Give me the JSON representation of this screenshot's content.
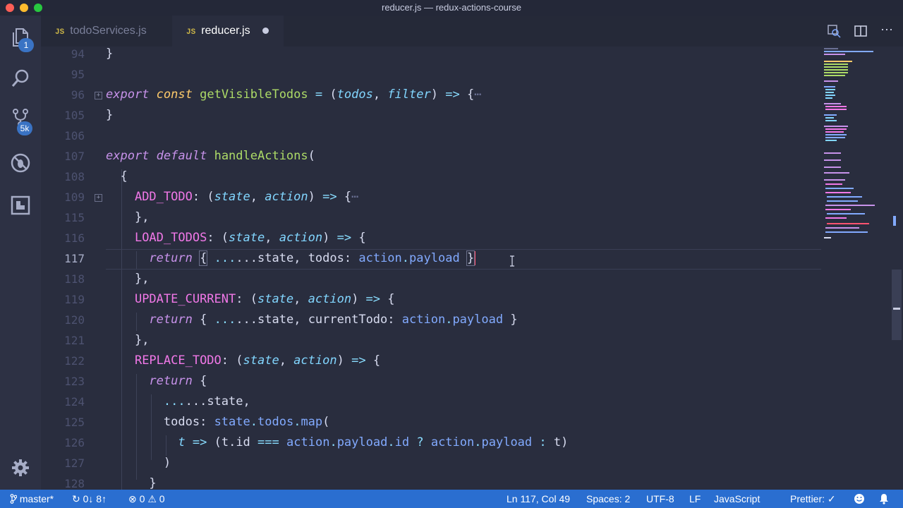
{
  "window": {
    "title": "reducer.js — redux-actions-course"
  },
  "activity_bar": {
    "explorer_badge": "1",
    "scm_badge": "5k"
  },
  "tabs": [
    {
      "icon": "JS",
      "label": "todoServices.js"
    },
    {
      "icon": "JS",
      "label": "reducer.js"
    }
  ],
  "editor": {
    "line_numbers": [
      "94",
      "95",
      "96",
      "105",
      "106",
      "107",
      "108",
      "109",
      "115",
      "116",
      "117",
      "118",
      "119",
      "120",
      "121",
      "122",
      "123",
      "124",
      "125",
      "126",
      "127",
      "128"
    ],
    "code": {
      "l94": "}",
      "l96_export": "export",
      "l96_const": "const",
      "l96_fn": "getVisibleTodos",
      "l96_eq": "=",
      "l96_p1": "todos",
      "l96_p2": "filter",
      "l96_fold": "⋯",
      "l105": "}",
      "l107_export": "export",
      "l107_default": "default",
      "l107_fn": "handleActions",
      "l108": "{",
      "l109_key": "ADD_TODO",
      "l109_p1": "state",
      "l109_p2": "action",
      "l109_fold": "⋯",
      "l115": "},",
      "l116_key": "LOAD_TODOS",
      "l116_p1": "state",
      "l116_p2": "action",
      "l117_return": "return",
      "l117_spread": "...state,",
      "l117_todos": "todos:",
      "l117_action": "action",
      "l117_payload": "payload",
      "l118": "},",
      "l119_key": "UPDATE_CURRENT",
      "l119_p1": "state",
      "l119_p2": "action",
      "l120_return": "return",
      "l120_spread": "...state,",
      "l120_cur": "currentTodo:",
      "l120_action": "action",
      "l120_payload": "payload",
      "l121": "},",
      "l122_key": "REPLACE_TODO",
      "l122_p1": "state",
      "l122_p2": "action",
      "l123_return": "return",
      "l124_spread": "...state,",
      "l125_todos": "todos:",
      "l125_state": "state",
      "l125_todos2": "todos",
      "l125_map": "map",
      "l126_t": "t",
      "l126_tid": "t.id",
      "l126_action": "action",
      "l126_payload": "payload",
      "l126_id": "id",
      "l126_action2": "action",
      "l126_payload2": "payload",
      "l126_t2": "t",
      "l127": ")",
      "l128": "}"
    }
  },
  "status_bar": {
    "branch": "master*",
    "sync": "0↓ 8↑",
    "errors": "0",
    "warnings": "0",
    "position": "Ln 117, Col 49",
    "spaces": "Spaces: 2",
    "encoding": "UTF-8",
    "eol": "LF",
    "language": "JavaScript",
    "prettier": "Prettier: ✓"
  }
}
